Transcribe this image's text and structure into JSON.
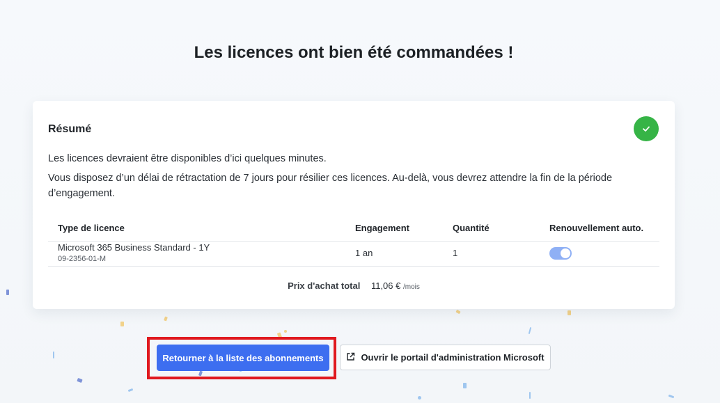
{
  "page": {
    "title": "Les licences ont bien été commandées !"
  },
  "summary": {
    "title": "Résumé",
    "message_availability": "Les licences devraient être disponibles d’ici quelques minutes.",
    "message_withdrawal": "Vous disposez d’un délai de rétractation de 7 jours pour résilier ces licences. Au-delà, vous devrez attendre la fin de la période d’engagement."
  },
  "table": {
    "headers": {
      "license_type": "Type de licence",
      "commitment": "Engagement",
      "quantity": "Quantité",
      "auto_renewal": "Renouvellement auto."
    },
    "rows": [
      {
        "name": "Microsoft 365 Business Standard - 1Y",
        "sku": "09-2356-01-M",
        "commitment": "1 an",
        "quantity": "1",
        "auto_renewal": true
      }
    ]
  },
  "total": {
    "label": "Prix d'achat total",
    "amount": "11,06 €",
    "unit": "/mois"
  },
  "actions": {
    "back_label": "Retourner à la liste des abonnements",
    "portal_label": "Ouvrir le portail d'administration Microsoft",
    "portal_icon": "external-link-icon"
  },
  "colors": {
    "primary": "#3d6ef0",
    "success": "#36b446",
    "highlight": "#e0191f"
  }
}
